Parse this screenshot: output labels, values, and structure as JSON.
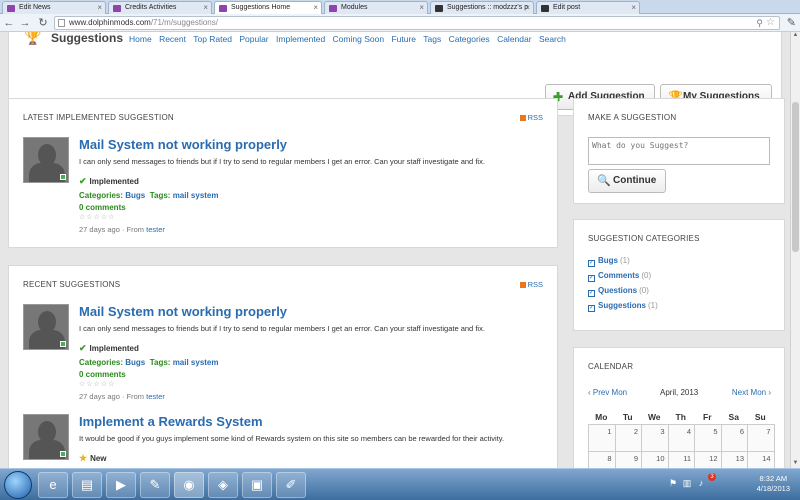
{
  "browser": {
    "tabs": [
      {
        "label": "Edit News"
      },
      {
        "label": "Credits Activities"
      },
      {
        "label": "Suggestions Home"
      },
      {
        "label": "Modules"
      },
      {
        "label": "Suggestions :: modzzz's p"
      },
      {
        "label": "Edit post"
      }
    ],
    "url_host": "www.dolphinmods.com",
    "url_path": "/71/m/suggestions/"
  },
  "header": {
    "title": "Suggestions",
    "nav": [
      "Home",
      "Recent",
      "Top Rated",
      "Popular",
      "Implemented",
      "Coming Soon",
      "Future",
      "Tags",
      "Categories",
      "Calendar",
      "Search"
    ],
    "add_button": "Add Suggestion",
    "my_button": "My Suggestions"
  },
  "latest": {
    "title": "LATEST IMPLEMENTED SUGGESTION",
    "rss": "RSS",
    "entry": {
      "title": "Mail System not working properly",
      "desc": "I can only send messages to friends but if I try to send to regular members I get an error. Can your staff investigate and fix.",
      "status": "Implemented",
      "categories_label": "Categories:",
      "categories_value": "Bugs",
      "tags_label": "Tags:",
      "tags_value": "mail system",
      "comments": "0 comments",
      "rating": "☆☆☆☆☆",
      "age": "27 days ago · From",
      "author": "tester"
    }
  },
  "recent": {
    "title": "RECENT SUGGESTIONS",
    "rss": "RSS",
    "entry1": {
      "title": "Mail System not working properly",
      "desc": "I can only send messages to friends but if I try to send to regular members I get an error. Can your staff investigate and fix.",
      "status": "Implemented",
      "categories_label": "Categories:",
      "categories_value": "Bugs",
      "tags_label": "Tags:",
      "tags_value": "mail system",
      "comments": "0 comments",
      "rating": "☆☆☆☆☆",
      "age": "27 days ago · From",
      "author": "tester"
    },
    "entry2": {
      "title": "Implement a Rewards System",
      "desc": "It would be good if you guys implement some kind of Rewards system on this site so members can be rewarded for their activity.",
      "status": "New"
    }
  },
  "make_suggestion": {
    "title": "MAKE A SUGGESTION",
    "placeholder": "What do you Suggest?",
    "button": "Continue"
  },
  "categories": {
    "title": "SUGGESTION CATEGORIES",
    "items": [
      {
        "name": "Bugs",
        "count": "(1)"
      },
      {
        "name": "Comments",
        "count": "(0)"
      },
      {
        "name": "Questions",
        "count": "(0)"
      },
      {
        "name": "Suggestions",
        "count": "(1)"
      }
    ]
  },
  "calendar": {
    "title": "CALENDAR",
    "prev": "‹ Prev Mon",
    "month": "April, 2013",
    "next": "Next Mon ›",
    "days": [
      "Mo",
      "Tu",
      "We",
      "Th",
      "Fr",
      "Sa",
      "Su"
    ],
    "cells": [
      "1",
      "2",
      "3",
      "4",
      "5",
      "6",
      "7",
      "8",
      "9",
      "10",
      "11",
      "12",
      "13",
      "14"
    ]
  },
  "taskbar": {
    "time": "8:32 AM",
    "date": "4/18/2013",
    "badge": "3"
  }
}
